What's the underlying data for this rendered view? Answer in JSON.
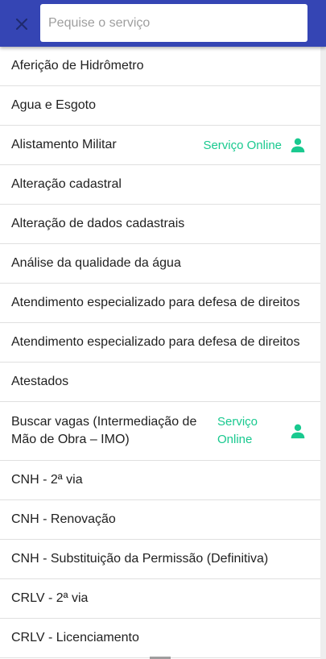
{
  "header": {
    "search_placeholder": "Pequise o serviço",
    "close_icon": "close-icon",
    "background_color": "#3545b4"
  },
  "online_label": "Serviço Online",
  "online_color": "#19c98f",
  "items": [
    {
      "label": "Aferição de Hidrômetro",
      "online": false
    },
    {
      "label": "Agua e Esgoto",
      "online": false
    },
    {
      "label": "Alistamento Militar",
      "online": true
    },
    {
      "label": "Alteração cadastral",
      "online": false
    },
    {
      "label": "Alteração de dados cadastrais",
      "online": false
    },
    {
      "label": "Análise da qualidade da água",
      "online": false
    },
    {
      "label": "Atendimento especializado para defesa de direitos",
      "online": false
    },
    {
      "label": "Atendimento especializado para defesa de direitos",
      "online": false
    },
    {
      "label": "Atestados",
      "online": false
    },
    {
      "label": "Buscar vagas (Intermediação de Mão de Obra – IMO)",
      "online": true
    },
    {
      "label": "CNH - 2ª via",
      "online": false
    },
    {
      "label": "CNH - Renovação",
      "online": false
    },
    {
      "label": "CNH - Substituição da Permissão (Definitiva)",
      "online": false
    },
    {
      "label": "CRLV - 2ª via",
      "online": false
    },
    {
      "label": "CRLV - Licenciamento",
      "online": false
    }
  ]
}
